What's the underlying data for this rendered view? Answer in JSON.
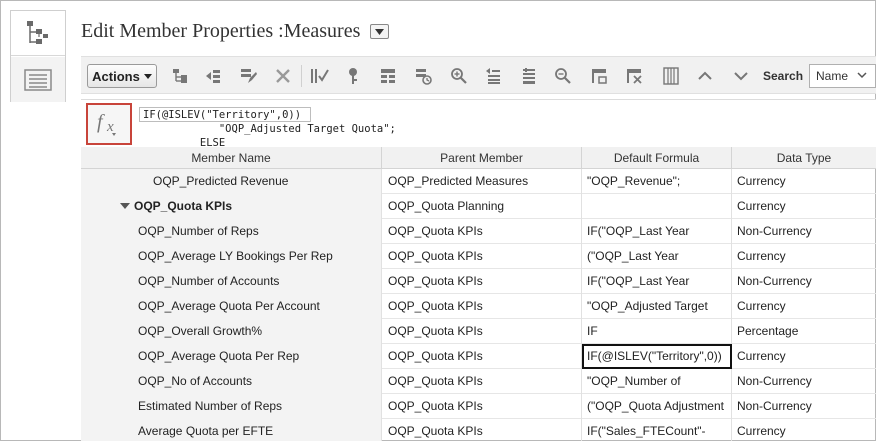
{
  "page": {
    "title": "Edit Member Properties :Measures"
  },
  "side_tabs": [
    {
      "name": "hierarchy-view-icon",
      "active": true
    },
    {
      "name": "list-view-icon",
      "active": false
    }
  ],
  "toolbar": {
    "actions_label": "Actions",
    "icons": [
      "add-child-icon",
      "add-sibling-icon",
      "edit-member-icon",
      "delete-icon",
      "validate-icon",
      "key-icon",
      "add-children-icon",
      "copy-icon",
      "zoom-in-icon",
      "move-up-icon",
      "move-down-icon",
      "zoom-out-icon",
      "shared-member-icon",
      "clear-icon",
      "grid-icon",
      "chevron-up-icon",
      "chevron-down-icon"
    ],
    "search_label": "Search",
    "search_option": "Name"
  },
  "formula": {
    "lines": [
      "IF(@ISLEV(\"Territory\",0))",
      "            \"OQP_Adjusted Target Quota\";",
      "         ELSE"
    ]
  },
  "grid": {
    "columns": [
      "Member Name",
      "Parent Member",
      "Default Formula",
      "Data Type"
    ],
    "rows": [
      {
        "name": "OQP_Predicted Revenue",
        "parent": "OQP_Predicted Measures",
        "formula": "\"OQP_Revenue\";",
        "type": "Currency",
        "bold": false,
        "expand": false,
        "level": 2
      },
      {
        "name": "OQP_Quota KPIs",
        "parent": "OQP_Quota Planning",
        "formula": "",
        "type": "Currency",
        "bold": true,
        "expand": true,
        "level": 1
      },
      {
        "name": "OQP_Number of Reps",
        "parent": "OQP_Quota KPIs",
        "formula": "IF(\"OQP_Last Year",
        "type": "Non-Currency",
        "bold": false,
        "expand": false,
        "level": 3
      },
      {
        "name": "OQP_Average LY Bookings Per Rep",
        "parent": "OQP_Quota KPIs",
        "formula": "(\"OQP_Last Year",
        "type": "Currency",
        "bold": false,
        "expand": false,
        "level": 3
      },
      {
        "name": "OQP_Number of Accounts",
        "parent": "OQP_Quota KPIs",
        "formula": "IF(\"OQP_Last Year",
        "type": "Non-Currency",
        "bold": false,
        "expand": false,
        "level": 3
      },
      {
        "name": "OQP_Average Quota Per Account",
        "parent": "OQP_Quota KPIs",
        "formula": "\"OQP_Adjusted Target",
        "type": "Currency",
        "bold": false,
        "expand": false,
        "level": 3
      },
      {
        "name": "OQP_Overall Growth%",
        "parent": "OQP_Quota KPIs",
        "formula": "IF",
        "type": "Percentage",
        "bold": false,
        "expand": false,
        "level": 3
      },
      {
        "name": "OQP_Average Quota Per Rep",
        "parent": "OQP_Quota KPIs",
        "formula": "IF(@ISLEV(\"Territory\",0))",
        "type": "Currency",
        "bold": false,
        "expand": false,
        "level": 3,
        "selected": true
      },
      {
        "name": "OQP_No of Accounts",
        "parent": "OQP_Quota KPIs",
        "formula": "\"OQP_Number of",
        "type": "Non-Currency",
        "bold": false,
        "expand": false,
        "level": 3
      },
      {
        "name": "Estimated Number of Reps",
        "parent": "OQP_Quota KPIs",
        "formula": "(\"OQP_Quota Adjustment",
        "type": "Non-Currency",
        "bold": false,
        "expand": false,
        "level": 3
      },
      {
        "name": "Average Quota per EFTE",
        "parent": "OQP_Quota KPIs",
        "formula": "IF(\"Sales_FTECount\"-",
        "type": "Currency",
        "bold": false,
        "expand": false,
        "level": 3
      }
    ]
  }
}
